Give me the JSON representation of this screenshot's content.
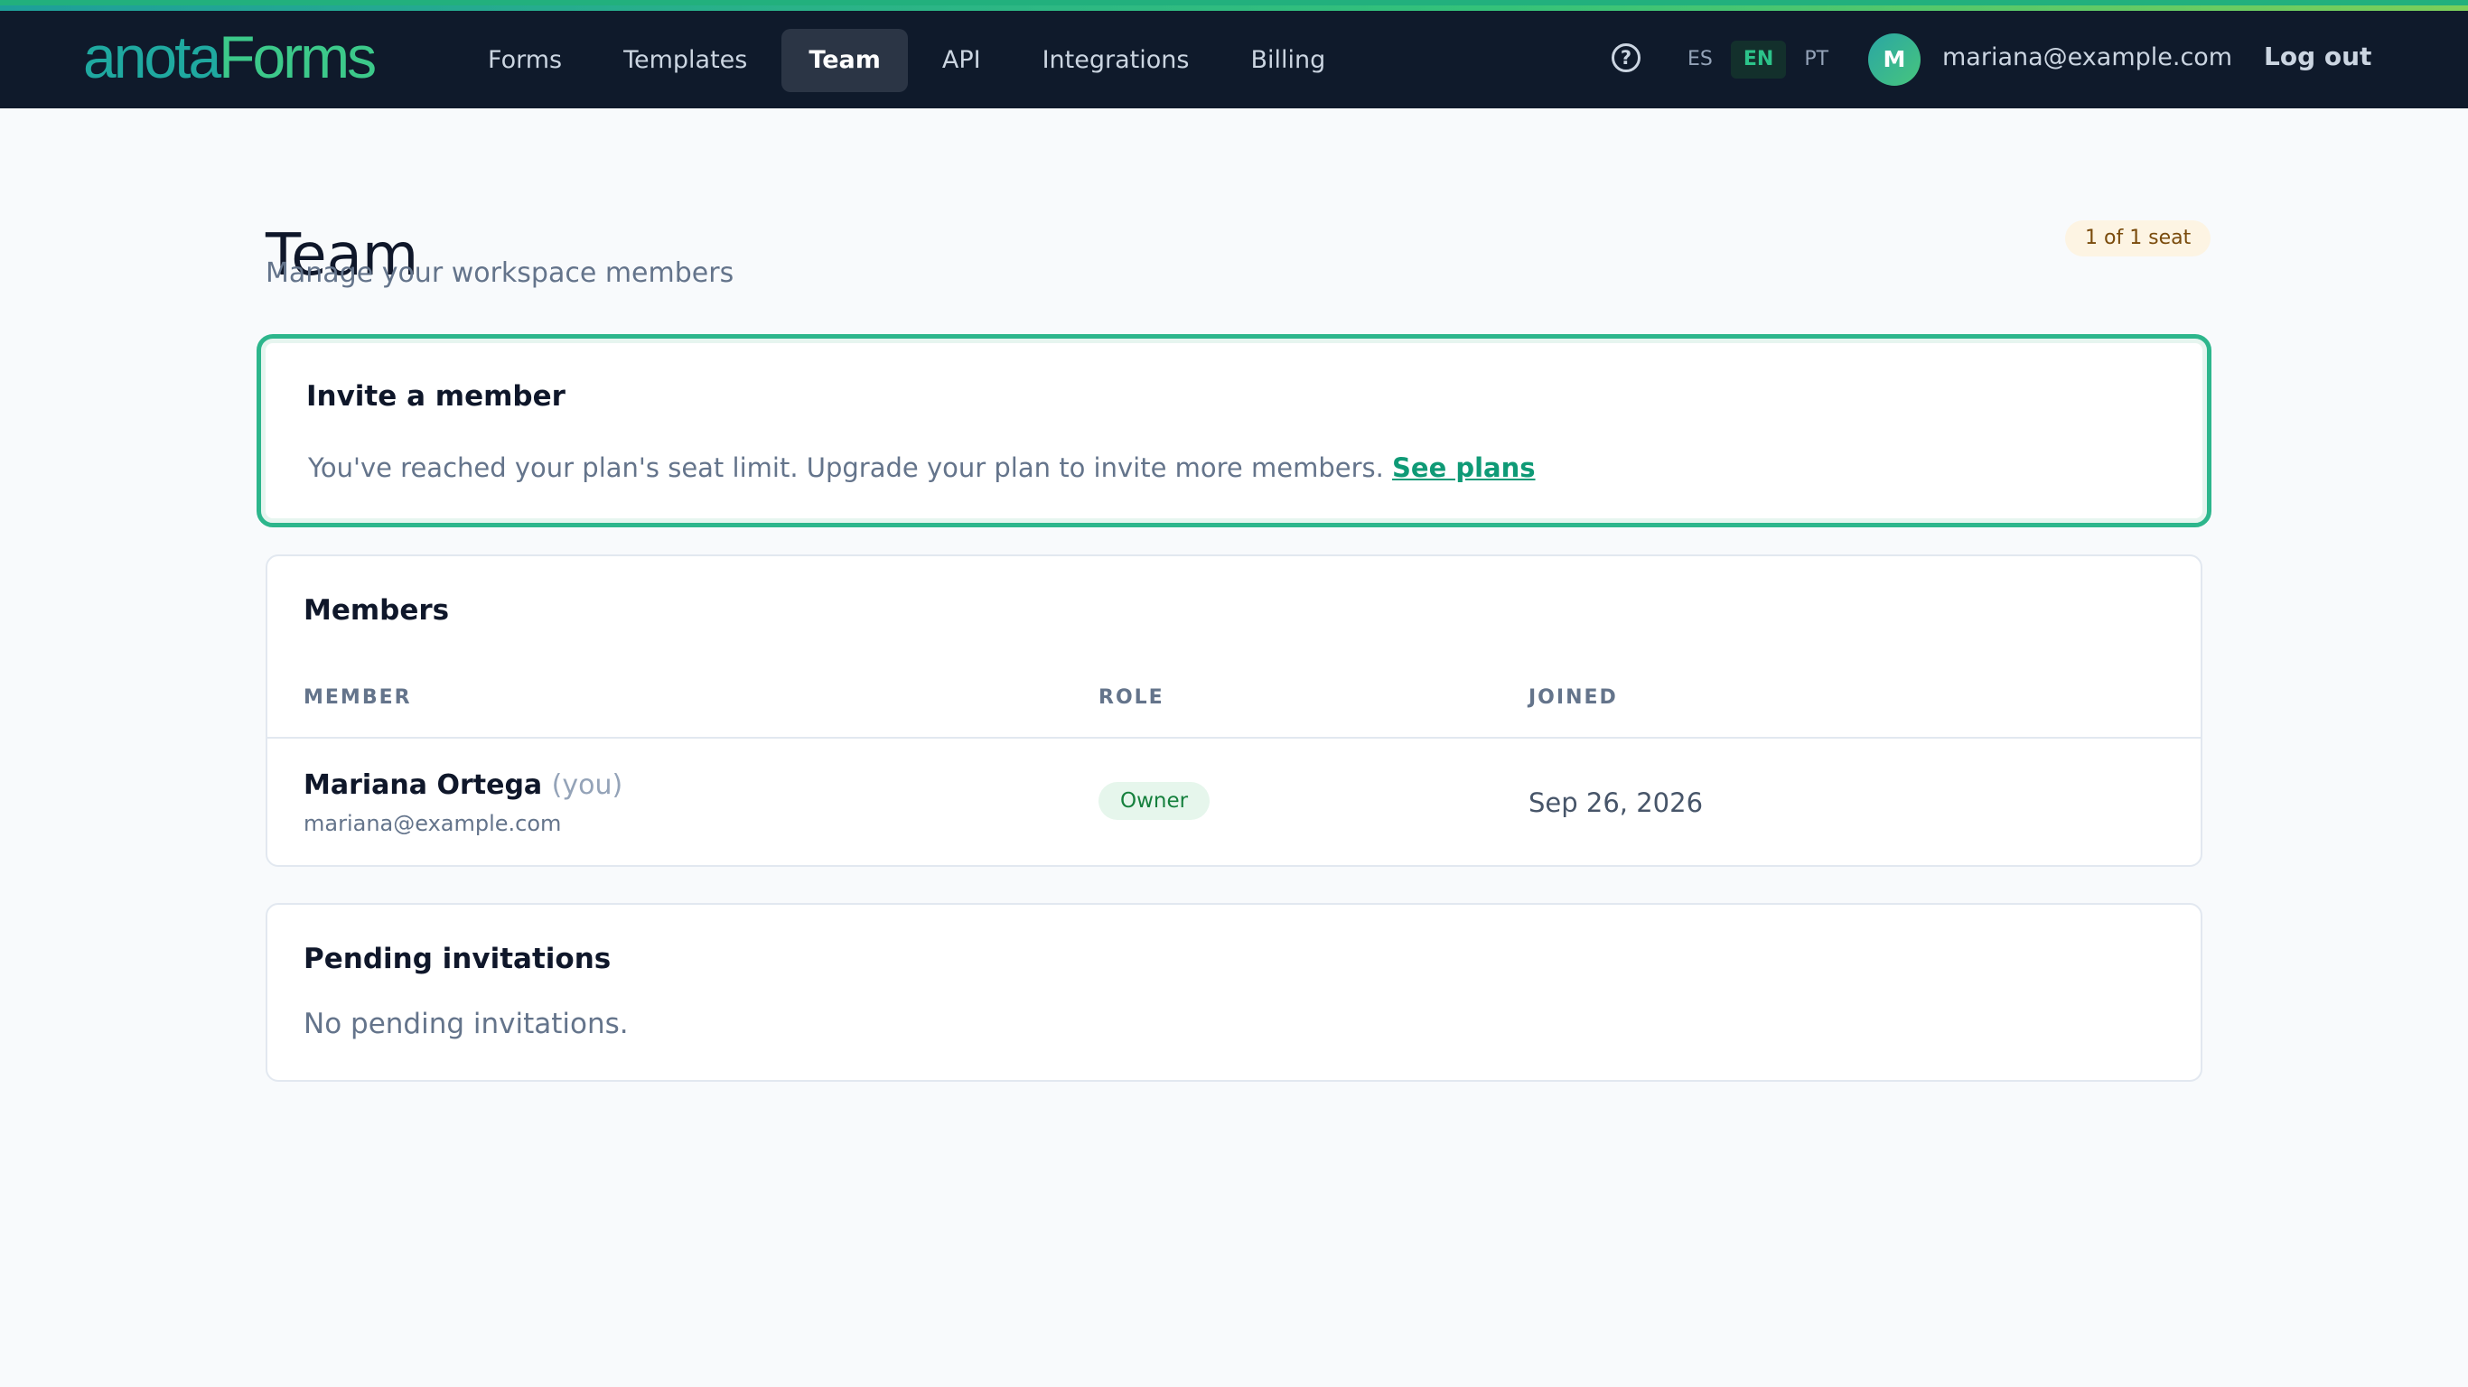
{
  "brand": {
    "logo_part1": "anota",
    "logo_part2": "Forms"
  },
  "nav": {
    "items": [
      {
        "label": "Forms",
        "active": false
      },
      {
        "label": "Templates",
        "active": false
      },
      {
        "label": "Team",
        "active": true
      },
      {
        "label": "API",
        "active": false
      },
      {
        "label": "Integrations",
        "active": false
      },
      {
        "label": "Billing",
        "active": false
      }
    ]
  },
  "header": {
    "help_glyph": "?",
    "languages": [
      {
        "code": "ES",
        "active": false
      },
      {
        "code": "EN",
        "active": true
      },
      {
        "code": "PT",
        "active": false
      }
    ],
    "avatar_initial": "M",
    "user_email": "mariana@example.com",
    "logout_label": "Log out"
  },
  "page": {
    "title": "Team",
    "subtitle": "Manage your workspace members",
    "seat_badge": "1 of 1 seat"
  },
  "invite": {
    "title": "Invite a member",
    "message": "You've reached your plan's seat limit. Upgrade your plan to invite more members.",
    "link_label": "See plans"
  },
  "members": {
    "title": "Members",
    "columns": [
      "MEMBER",
      "ROLE",
      "JOINED"
    ],
    "rows": [
      {
        "name": "Mariana Ortega",
        "you_label": "(you)",
        "email": "mariana@example.com",
        "role": "Owner",
        "joined": "Sep 26, 2026"
      }
    ]
  },
  "pending": {
    "title": "Pending invitations",
    "empty_message": "No pending invitations."
  },
  "colors": {
    "topbar": "#0f1a2b",
    "accent": "#2db68c",
    "link": "#0f9a76",
    "owner_badge_bg": "#e6f6ec",
    "seat_badge_bg": "#fdf4e3"
  },
  "icons": {
    "help": "help-circle-icon"
  }
}
